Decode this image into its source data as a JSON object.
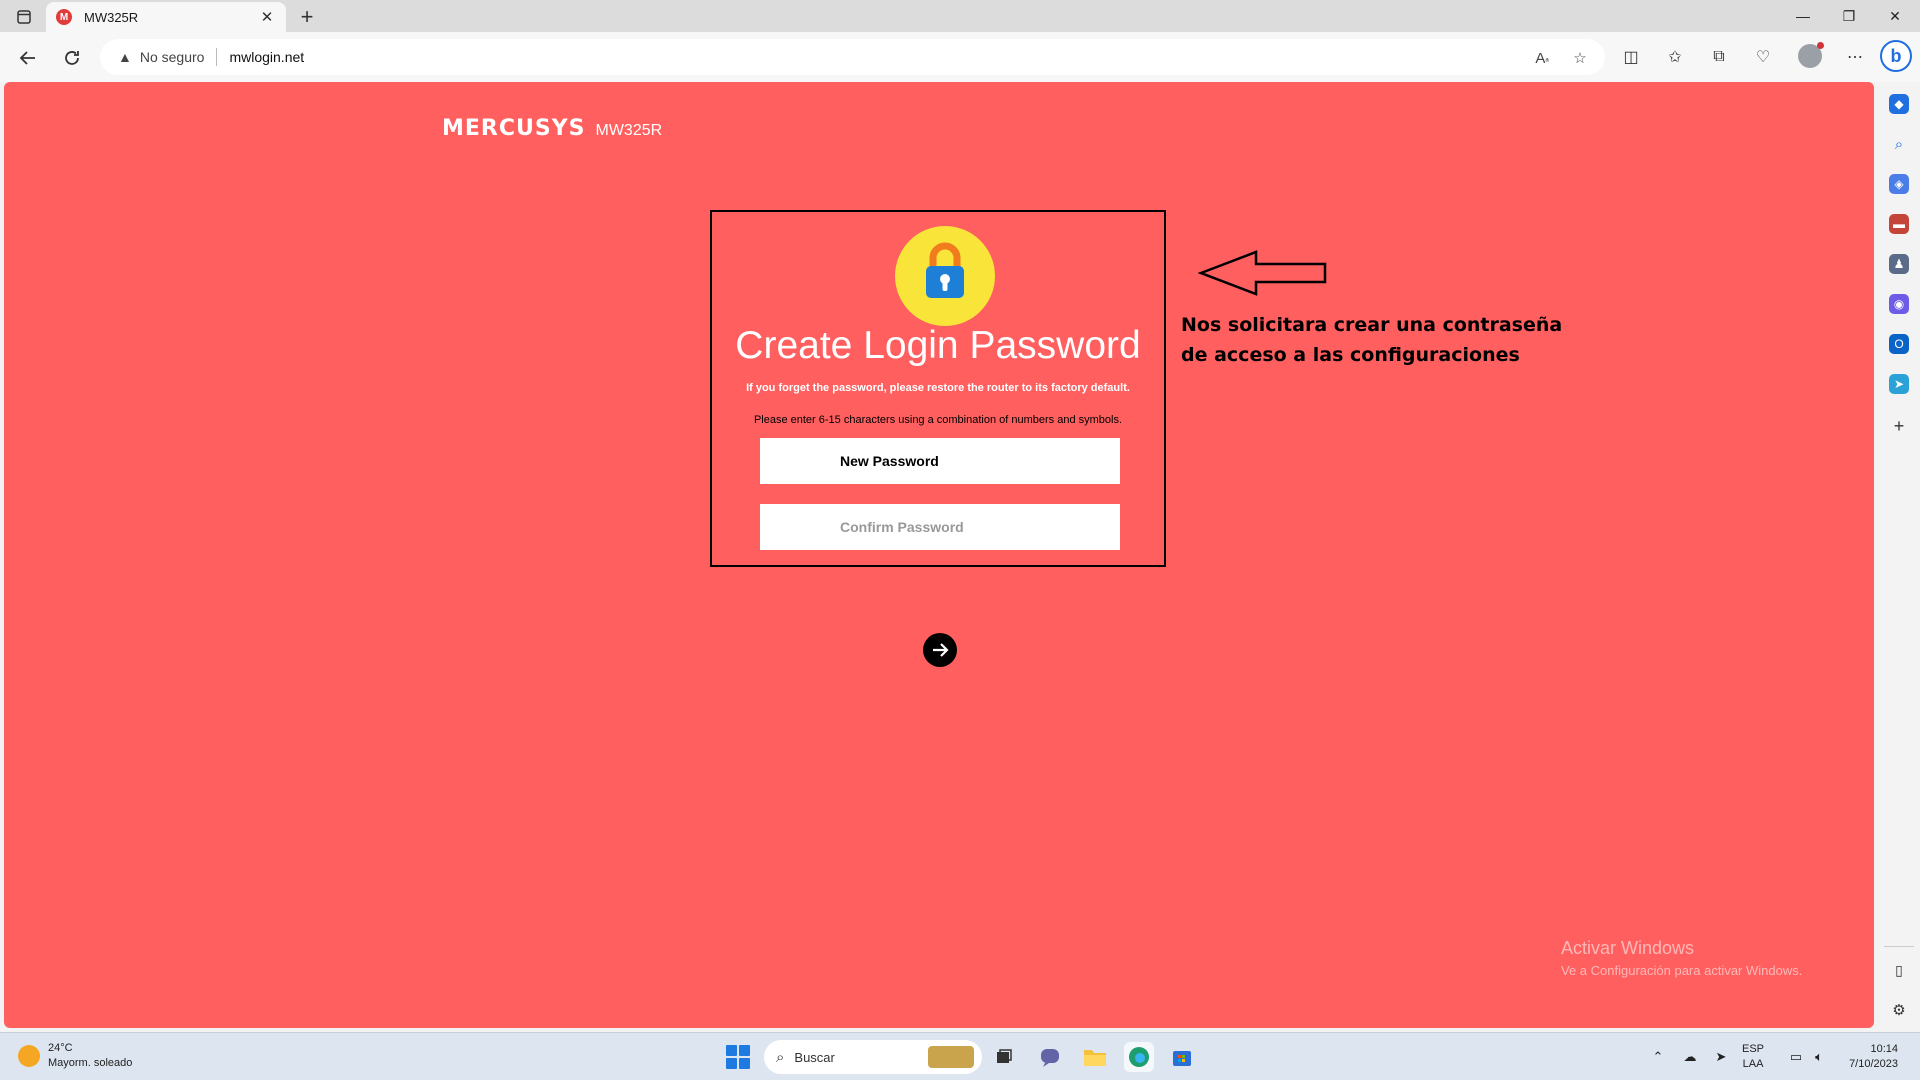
{
  "browser": {
    "tab": {
      "title": "MW325R",
      "favicon_letter": "M"
    },
    "address": {
      "security_label": "No seguro",
      "url": "mwlogin.net"
    }
  },
  "page": {
    "brand_logo": "MERCUSYS",
    "brand_model": "MW325R",
    "form": {
      "title": "Create Login Password",
      "warning": "If you forget the password, please restore the router to its factory default.",
      "hint": "Please enter 6-15 characters using a combination of numbers and symbols.",
      "new_password_placeholder": "New Password",
      "confirm_password_placeholder": "Confirm Password"
    },
    "annotation": {
      "line1": "Nos solicitara crear una contraseña",
      "line2": "de acceso a las configuraciones"
    },
    "watermark": {
      "line1": "Activar Windows",
      "line2": "Ve a Configuración para activar Windows."
    }
  },
  "taskbar": {
    "weather": {
      "temp": "24°C",
      "condition": "Mayorm. soleado"
    },
    "search_label": "Buscar",
    "language": {
      "line1": "ESP",
      "line2": "LAA"
    },
    "clock": {
      "time": "10:14",
      "date": "7/10/2023"
    }
  },
  "colors": {
    "page_background": "#ff5f5f",
    "lock_circle": "#f9e43a",
    "lock_shackle": "#f07c1e",
    "lock_body": "#1e7fd6"
  }
}
